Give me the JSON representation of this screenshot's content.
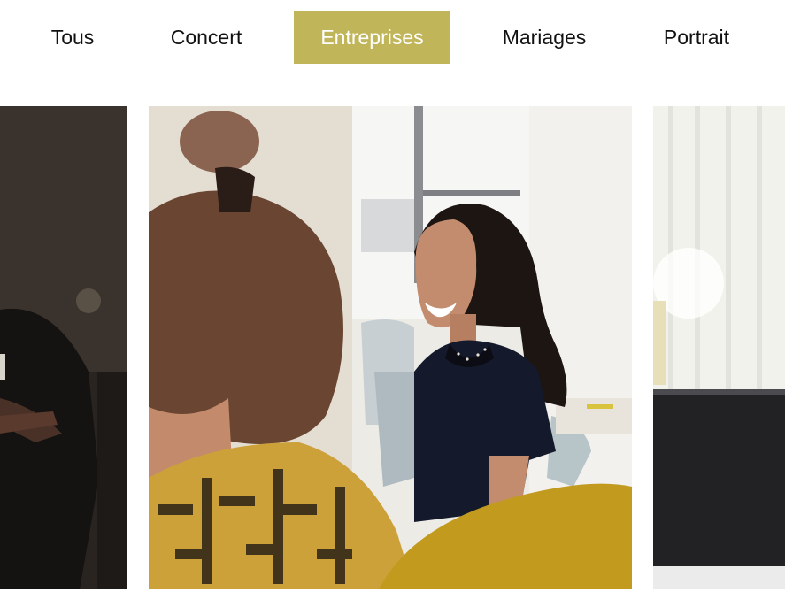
{
  "filters": {
    "items": [
      "Tous",
      "Concert",
      "Entreprises",
      "Mariages",
      "Portrait"
    ],
    "active_label": "Entreprises"
  },
  "colors": {
    "accent": "#c1b55a",
    "text": "#111111",
    "background": "#ffffff"
  },
  "gallery": {
    "photos": [
      {
        "name": "photo-left-partial",
        "subject": "person in dark jacket with crossed arms, dark background"
      },
      {
        "name": "photo-center-entreprises",
        "subject": "smiling woman in navy top at office meeting, blurred person in foreground"
      },
      {
        "name": "photo-right-partial",
        "subject": "bright room with white curtain and dark laptop"
      }
    ]
  }
}
